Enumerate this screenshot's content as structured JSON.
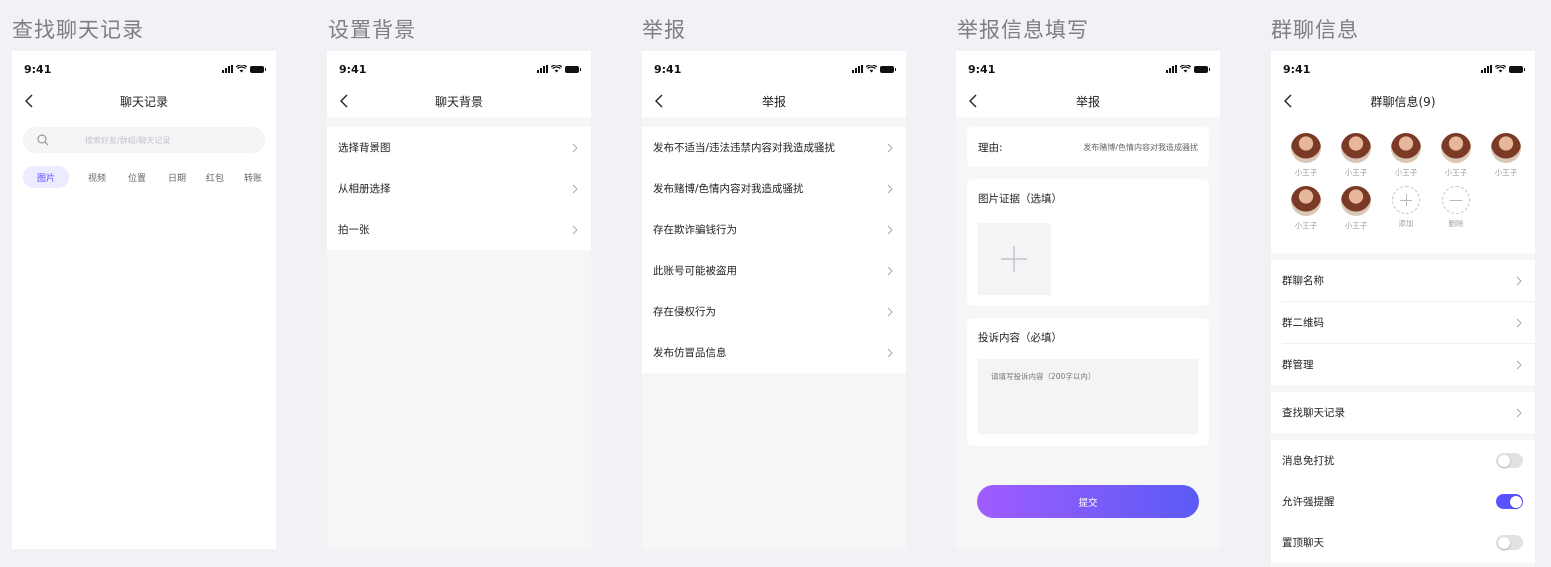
{
  "status_time": "9:41",
  "screens": {
    "search_history": {
      "section_title": "查找聊天记录",
      "nav_title": "聊天记录",
      "search_placeholder": "搜索好友/群组/聊天记录",
      "filters": [
        "图片",
        "视频",
        "位置",
        "日期",
        "红包",
        "转账"
      ]
    },
    "background": {
      "section_title": "设置背景",
      "nav_title": "聊天背景",
      "items": [
        "选择背景图",
        "从相册选择",
        "拍一张"
      ]
    },
    "report": {
      "section_title": "举报",
      "nav_title": "举报",
      "items": [
        "发布不适当/违法违禁内容对我造成骚扰",
        "发布赌博/色情内容对我造成骚扰",
        "存在欺诈骗钱行为",
        "此账号可能被盗用",
        "存在侵权行为",
        "发布仿冒品信息"
      ]
    },
    "report_form": {
      "section_title": "举报信息填写",
      "nav_title": "举报",
      "reason_label": "理由:",
      "reason_value": "发布赌博/色情内容对我造成骚扰",
      "evidence_label": "图片证据（选填）",
      "complaint_label": "投诉内容（必填）",
      "complaint_placeholder": "请填写投诉内容（200字以内）",
      "submit_label": "提交",
      "submit_colors": [
        "#a05cff",
        "#5b5bf5"
      ]
    },
    "group_info": {
      "section_title": "群聊信息",
      "nav_title": "群聊信息(9)",
      "members": [
        "小王子",
        "小王子",
        "小王子",
        "小王子",
        "小王子",
        "小王子",
        "小王子"
      ],
      "add_label": "添加",
      "remove_label": "删除",
      "settings_a": [
        "群聊名称",
        "群二维码",
        "群管理"
      ],
      "settings_b": [
        "查找聊天记录"
      ],
      "toggles": [
        {
          "label": "消息免打扰",
          "on": false
        },
        {
          "label": "允许强提醒",
          "on": true
        },
        {
          "label": "置顶聊天",
          "on": false
        }
      ],
      "accent": "#5b52ff"
    }
  }
}
